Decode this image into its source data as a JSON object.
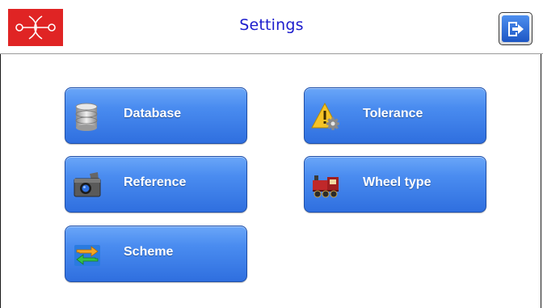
{
  "header": {
    "title": "Settings",
    "title_color": "#1c1ccd",
    "logo_icon": "wheel-axle-logo-icon",
    "logo_color": "#e02424",
    "exit_icon": "exit-arrow-icon"
  },
  "buttons": [
    {
      "label": "Database",
      "icon": "database-icon"
    },
    {
      "label": "Reference",
      "icon": "camera-icon"
    },
    {
      "label": "Scheme",
      "icon": "swap-arrows-icon"
    },
    {
      "label": "Tolerance",
      "icon": "warning-gear-icon"
    },
    {
      "label": "Wheel type",
      "icon": "locomotive-icon"
    }
  ],
  "colors": {
    "button_top": "#6aa6f8",
    "button_bottom": "#2f6fdf",
    "button_border": "#1f4fa8"
  }
}
